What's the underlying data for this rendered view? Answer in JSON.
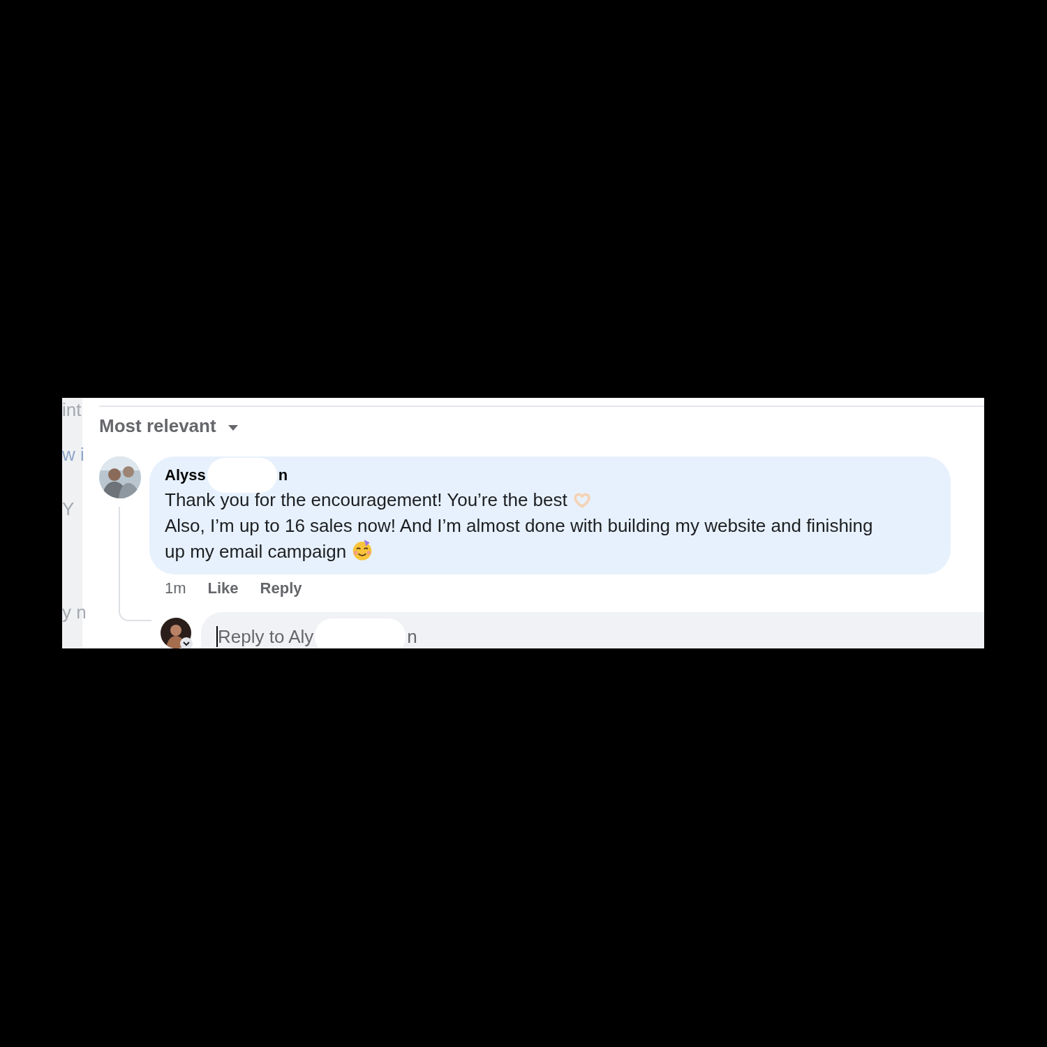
{
  "side_fragments": [
    "int",
    "w i",
    "Y",
    "y n"
  ],
  "sort_menu": {
    "label": "Most relevant"
  },
  "comment": {
    "author_parts": [
      "Alyss",
      "n"
    ],
    "lines": [
      "Thank you for the encouragement! You’re the best",
      "Also, I’m up to 16 sales now! And I’m almost done with building my website and finishing up my email campaign"
    ],
    "time": "1m",
    "actions": [
      "Like",
      "Reply"
    ]
  },
  "reply_box": {
    "hint_parts": [
      "Reply to Aly",
      "n"
    ]
  }
}
